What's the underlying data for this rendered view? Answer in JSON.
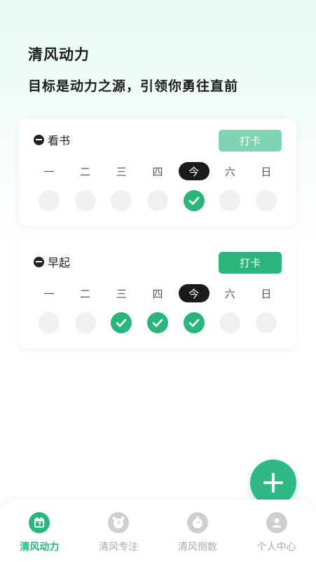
{
  "header": {
    "title": "清风动力",
    "subtitle": "目标是动力之源，引领你勇往直前"
  },
  "habits": [
    {
      "name": "看书",
      "checkin_label": "打卡",
      "button_color": "#7fd4b1",
      "days": [
        "一",
        "二",
        "三",
        "四",
        "今",
        "六",
        "日"
      ],
      "today_index": 4,
      "done": [
        false,
        false,
        false,
        false,
        true,
        false,
        false
      ]
    },
    {
      "name": "早起",
      "checkin_label": "打卡",
      "button_color": "#2ab57d",
      "days": [
        "一",
        "二",
        "三",
        "四",
        "今",
        "六",
        "日"
      ],
      "today_index": 4,
      "done": [
        false,
        false,
        true,
        true,
        true,
        false,
        false
      ]
    }
  ],
  "fab": {
    "icon": "plus-icon"
  },
  "tabbar": {
    "tabs": [
      {
        "label": "清风动力",
        "icon": "calendar-icon",
        "active": true
      },
      {
        "label": "清风专注",
        "icon": "alarm-clock-icon",
        "active": false
      },
      {
        "label": "清风倒数",
        "icon": "stopwatch-icon",
        "active": false
      },
      {
        "label": "个人中心",
        "icon": "person-icon",
        "active": false
      }
    ]
  },
  "colors": {
    "accent": "#2ab57d",
    "today_bg": "#1a1a1a"
  }
}
